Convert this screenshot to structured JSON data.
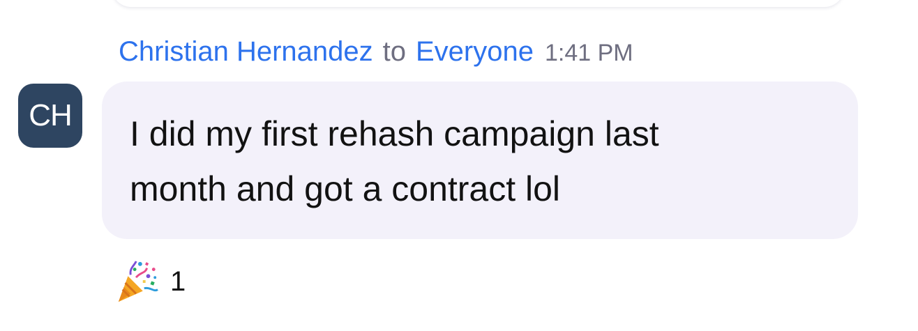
{
  "message": {
    "sender": "Christian Hernandez",
    "to_word": "to",
    "recipient": "Everyone",
    "time": "1:41 PM",
    "avatar_initials": "CH",
    "text": "I did my first rehash campaign last month and got a contract lol"
  },
  "reaction": {
    "icon": "party-popper-icon",
    "count": "1"
  },
  "colors": {
    "name_blue": "#2d72ed",
    "muted_gray": "#6e6e80",
    "avatar_bg": "#2e4561",
    "bubble_bg": "#f3f1fa"
  }
}
